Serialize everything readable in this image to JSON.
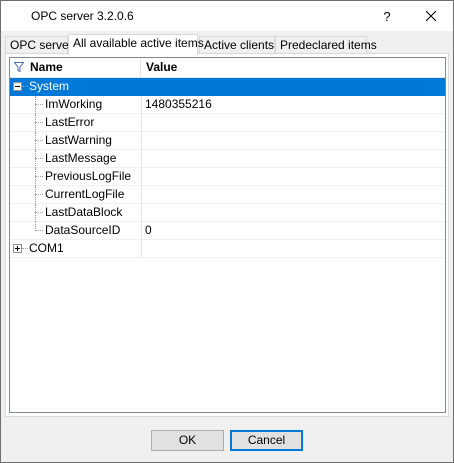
{
  "window": {
    "title": "OPC server 3.2.0.6",
    "help_label": "?"
  },
  "tabs": [
    {
      "label": "OPC server",
      "active": false
    },
    {
      "label": "All available active items",
      "active": true
    },
    {
      "label": "Active clients",
      "active": false
    },
    {
      "label": "Predeclared items",
      "active": false
    }
  ],
  "grid": {
    "columns": [
      "Name",
      "Value"
    ],
    "rows": [
      {
        "name": "System",
        "value": "",
        "level": 0,
        "expander": "minus",
        "selected": true
      },
      {
        "name": "ImWorking",
        "value": "1480355216",
        "level": 1
      },
      {
        "name": "LastError",
        "value": "",
        "level": 1
      },
      {
        "name": "LastWarning",
        "value": "",
        "level": 1
      },
      {
        "name": "LastMessage",
        "value": "",
        "level": 1
      },
      {
        "name": "PreviousLogFile",
        "value": "",
        "level": 1
      },
      {
        "name": "CurrentLogFile",
        "value": "",
        "level": 1
      },
      {
        "name": "LastDataBlock",
        "value": "",
        "level": 1
      },
      {
        "name": "DataSourceID",
        "value": "0",
        "level": 1
      },
      {
        "name": "COM1",
        "value": "",
        "level": 0,
        "expander": "plus"
      }
    ]
  },
  "footer": {
    "ok_label": "OK",
    "cancel_label": "Cancel"
  },
  "colors": {
    "selection": "#0078d7",
    "window_bg": "#f0f0f0"
  }
}
